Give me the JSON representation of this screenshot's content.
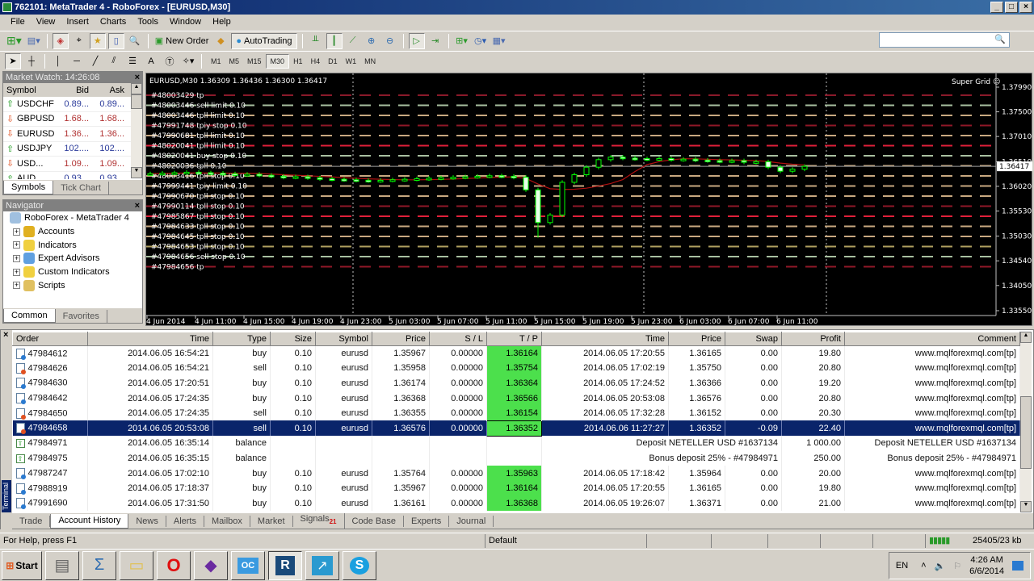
{
  "window": {
    "title": "762101: MetaTrader 4 - RoboForex - [EURUSD,M30]",
    "min": "_",
    "max": "□",
    "close": "×"
  },
  "menu": [
    "File",
    "View",
    "Insert",
    "Charts",
    "Tools",
    "Window",
    "Help"
  ],
  "toolbar": {
    "new_order": "New Order",
    "autotrading": "AutoTrading",
    "timeframes": [
      "M1",
      "M5",
      "M15",
      "M30",
      "H1",
      "H4",
      "D1",
      "W1",
      "MN"
    ],
    "active_timeframe": "M30",
    "draw_text": "A"
  },
  "market_watch": {
    "title": "Market Watch: 14:26:08",
    "headers": [
      "Symbol",
      "Bid",
      "Ask"
    ],
    "rows": [
      {
        "symbol": "USDCHF",
        "bid": "0.89...",
        "ask": "0.89...",
        "dir": "up"
      },
      {
        "symbol": "GBPUSD",
        "bid": "1.68...",
        "ask": "1.68...",
        "dir": "down"
      },
      {
        "symbol": "EURUSD",
        "bid": "1.36...",
        "ask": "1.36...",
        "dir": "down"
      },
      {
        "symbol": "USDJPY",
        "bid": "102....",
        "ask": "102....",
        "dir": "up"
      },
      {
        "symbol": "USD...",
        "bid": "1.09...",
        "ask": "1.09...",
        "dir": "down"
      },
      {
        "symbol": "AUD...",
        "bid": "0.93...",
        "ask": "0.93...",
        "dir": "up"
      }
    ],
    "tabs": [
      "Symbols",
      "Tick Chart"
    ]
  },
  "navigator": {
    "title": "Navigator",
    "root": "RoboForex - MetaTrader 4",
    "items": [
      "Accounts",
      "Indicators",
      "Expert Advisors",
      "Custom Indicators",
      "Scripts"
    ],
    "tabs": [
      "Common",
      "Favorites"
    ]
  },
  "chart": {
    "header": "EURUSD,M30  1.36309 1.36436 1.36300 1.36417",
    "indicator": "Super Grid ☺",
    "current_price": "1.36417",
    "price_ticks": [
      "1.37990",
      "1.37500",
      "1.37010",
      "1.36510",
      "1.36020",
      "1.35530",
      "1.35030",
      "1.34540",
      "1.34050",
      "1.33550"
    ],
    "time_ticks": [
      "4 Jun 2014",
      "4 Jun 11:00",
      "4 Jun 15:00",
      "4 Jun 19:00",
      "4 Jun 23:00",
      "5 Jun 03:00",
      "5 Jun 07:00",
      "5 Jun 11:00",
      "5 Jun 15:00",
      "5 Jun 19:00",
      "5 Jun 23:00",
      "6 Jun 03:00",
      "6 Jun 07:00",
      "6 Jun 11:00"
    ],
    "orders": [
      {
        "label": "#48003429 tp",
        "color": "#8a1a2a"
      },
      {
        "label": "#48003446 sell limit 0.10",
        "color": "#a8c0a0"
      },
      {
        "label": "#48003446 tpll limit 0.10",
        "color": "#c8a880"
      },
      {
        "label": "#47991748 tpiy stop 0.10",
        "color": "#901828"
      },
      {
        "label": "#47990681 tpll limit 0.10",
        "color": "#c8a880"
      },
      {
        "label": "#48020041 tpll limit 0.10",
        "color": "#e0203a"
      },
      {
        "label": "#48020041 buy stop 0.10",
        "color": "#a8c0a0"
      },
      {
        "label": "#48020036 tpll 0.10",
        "color": "#c8a880"
      },
      {
        "label": "#48003416 tpll stop 0.10",
        "color": "#c8a880"
      },
      {
        "label": "#47999441 tpiy limit 0.10",
        "color": "#c8a880"
      },
      {
        "label": "#47990670 tpll stop 0.10",
        "color": "#c8a880"
      },
      {
        "label": "#47990114 tpll stop 0.10",
        "color": "#901828"
      },
      {
        "label": "#47985867 tpll stop 0.10",
        "color": "#e0203a"
      },
      {
        "label": "#47984633 tpll stop 0.10",
        "color": "#c8a880"
      },
      {
        "label": "#47984645 tpll stop 0.10",
        "color": "#c8a880"
      },
      {
        "label": "#47984653 tpll stop 0.10",
        "color": "#b0a060"
      },
      {
        "label": "#47984656 sell stop 0.10",
        "color": "#a8c0a0"
      },
      {
        "label": "#47984656 tp",
        "color": "#901828"
      }
    ]
  },
  "chart_data": {
    "type": "candlestick",
    "symbol": "EURUSD",
    "timeframe": "M30",
    "ylim": [
      1.3355,
      1.3799
    ],
    "candle_color": "#00ff00",
    "ma_color": "#b01010",
    "closes": [
      1.3627,
      1.3628,
      1.3629,
      1.363,
      1.3629,
      1.3628,
      1.3627,
      1.3625,
      1.3626,
      1.3624,
      1.3622,
      1.362,
      1.3621,
      1.3619,
      1.3617,
      1.3616,
      1.3615,
      1.3614,
      1.3613,
      1.3614,
      1.3615,
      1.3616,
      1.3617,
      1.3618,
      1.3619,
      1.362,
      1.3621,
      1.3622,
      1.3623,
      1.3622,
      1.362,
      1.3595,
      1.353,
      1.3545,
      1.361,
      1.3625,
      1.364,
      1.3655,
      1.366,
      1.3658,
      1.3657,
      1.3656,
      1.3657,
      1.3655,
      1.3656,
      1.3654,
      1.3653,
      1.3652,
      1.3653,
      1.365,
      1.3651,
      1.364,
      1.3632,
      1.3636,
      1.36417
    ]
  },
  "terminal": {
    "label": "Terminal",
    "headers": [
      "Order",
      "Time",
      "Type",
      "Size",
      "Symbol",
      "Price",
      "S / L",
      "T / P",
      "Time",
      "Price",
      "Swap",
      "Profit",
      "Comment"
    ],
    "rows": [
      {
        "order": "47984612",
        "time": "2014.06.05 16:54:21",
        "type": "buy",
        "size": "0.10",
        "symbol": "eurusd",
        "price": "1.35967",
        "sl": "0.00000",
        "tp": "1.36164",
        "ctime": "2014.06.05 17:20:55",
        "cprice": "1.36165",
        "swap": "0.00",
        "profit": "19.80",
        "comment": "www.mqlforexmql.com[tp]"
      },
      {
        "order": "47984626",
        "time": "2014.06.05 16:54:21",
        "type": "sell",
        "size": "0.10",
        "symbol": "eurusd",
        "price": "1.35958",
        "sl": "0.00000",
        "tp": "1.35754",
        "ctime": "2014.06.05 17:02:19",
        "cprice": "1.35750",
        "swap": "0.00",
        "profit": "20.80",
        "comment": "www.mqlforexmql.com[tp]"
      },
      {
        "order": "47984630",
        "time": "2014.06.05 17:20:51",
        "type": "buy",
        "size": "0.10",
        "symbol": "eurusd",
        "price": "1.36174",
        "sl": "0.00000",
        "tp": "1.36364",
        "ctime": "2014.06.05 17:24:52",
        "cprice": "1.36366",
        "swap": "0.00",
        "profit": "19.20",
        "comment": "www.mqlforexmql.com[tp]"
      },
      {
        "order": "47984642",
        "time": "2014.06.05 17:24:35",
        "type": "buy",
        "size": "0.10",
        "symbol": "eurusd",
        "price": "1.36368",
        "sl": "0.00000",
        "tp": "1.36566",
        "ctime": "2014.06.05 20:53:08",
        "cprice": "1.36576",
        "swap": "0.00",
        "profit": "20.80",
        "comment": "www.mqlforexmql.com[tp]"
      },
      {
        "order": "47984650",
        "time": "2014.06.05 17:24:35",
        "type": "sell",
        "size": "0.10",
        "symbol": "eurusd",
        "price": "1.36355",
        "sl": "0.00000",
        "tp": "1.36154",
        "ctime": "2014.06.05 17:32:28",
        "cprice": "1.36152",
        "swap": "0.00",
        "profit": "20.30",
        "comment": "www.mqlforexmql.com[tp]"
      },
      {
        "order": "47984658",
        "time": "2014.06.05 20:53:08",
        "type": "sell",
        "size": "0.10",
        "symbol": "eurusd",
        "price": "1.36576",
        "sl": "0.00000",
        "tp": "1.36352",
        "ctime": "2014.06.06 11:27:27",
        "cprice": "1.36352",
        "swap": "-0.09",
        "profit": "22.40",
        "comment": "www.mqlforexmql.com[tp]",
        "selected": true
      },
      {
        "order": "47984971",
        "time": "2014.06.05 16:35:14",
        "type": "balance",
        "desc": "Deposit NETELLER USD #1637134",
        "profit": "1 000.00",
        "comment": "Deposit NETELLER USD #1637134"
      },
      {
        "order": "47984975",
        "time": "2014.06.05 16:35:15",
        "type": "balance",
        "desc": "Bonus deposit 25% - #47984971",
        "profit": "250.00",
        "comment": "Bonus deposit 25% - #47984971"
      },
      {
        "order": "47987247",
        "time": "2014.06.05 17:02:10",
        "type": "buy",
        "size": "0.10",
        "symbol": "eurusd",
        "price": "1.35764",
        "sl": "0.00000",
        "tp": "1.35963",
        "ctime": "2014.06.05 17:18:42",
        "cprice": "1.35964",
        "swap": "0.00",
        "profit": "20.00",
        "comment": "www.mqlforexmql.com[tp]"
      },
      {
        "order": "47988919",
        "time": "2014.06.05 17:18:37",
        "type": "buy",
        "size": "0.10",
        "symbol": "eurusd",
        "price": "1.35967",
        "sl": "0.00000",
        "tp": "1.36164",
        "ctime": "2014.06.05 17:20:55",
        "cprice": "1.36165",
        "swap": "0.00",
        "profit": "19.80",
        "comment": "www.mqlforexmql.com[tp]"
      },
      {
        "order": "47991690",
        "time": "2014.06.05 17:31:50",
        "type": "buy",
        "size": "0.10",
        "symbol": "eurusd",
        "price": "1.36161",
        "sl": "0.00000",
        "tp": "1.36368",
        "ctime": "2014.06.05 19:26:07",
        "cprice": "1.36371",
        "swap": "0.00",
        "profit": "21.00",
        "comment": "www.mqlforexmql.com[tp]"
      }
    ],
    "tabs": [
      "Trade",
      "Account History",
      "News",
      "Alerts",
      "Mailbox",
      "Market",
      "Signals",
      "Code Base",
      "Experts",
      "Journal"
    ],
    "active_tab": "Account History",
    "signals_badge": "21"
  },
  "status": {
    "help": "For Help, press F1",
    "profile": "Default",
    "traffic": "25405/23 kb"
  },
  "taskbar": {
    "start": "Start",
    "lang": "EN",
    "time": "4:26 AM",
    "date": "6/6/2014"
  }
}
